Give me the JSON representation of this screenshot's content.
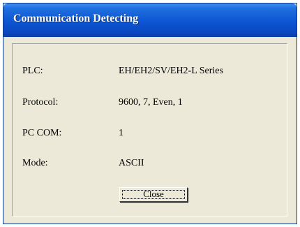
{
  "window": {
    "title": "Communication Detecting"
  },
  "fields": [
    {
      "label": "PLC:",
      "value": "EH/EH2/SV/EH2-L Series"
    },
    {
      "label": "Protocol:",
      "value": "9600, 7, Even, 1"
    },
    {
      "label": "PC COM:",
      "value": "1"
    },
    {
      "label": "Mode:",
      "value": "ASCII"
    }
  ],
  "buttons": {
    "close_label": "Close"
  },
  "colors": {
    "titlebar": "#0c55d2",
    "title_text": "#ffffff",
    "dialog_face": "#ece9d8"
  }
}
